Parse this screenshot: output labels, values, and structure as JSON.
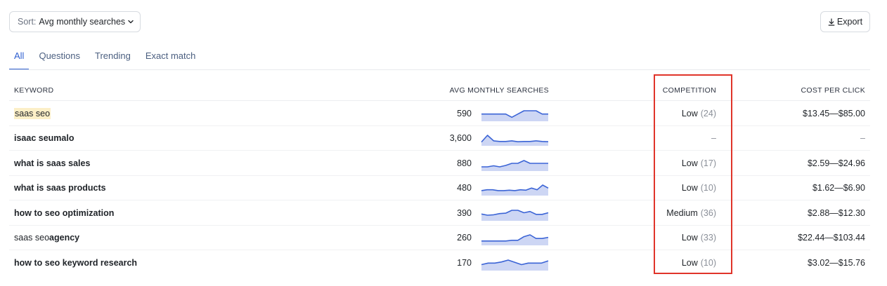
{
  "toolbar": {
    "sort_prefix": "Sort:",
    "sort_value": "Avg monthly searches",
    "export_label": "Export"
  },
  "tabs": [
    {
      "label": "All",
      "active": true
    },
    {
      "label": "Questions",
      "active": false
    },
    {
      "label": "Trending",
      "active": false
    },
    {
      "label": "Exact match",
      "active": false
    }
  ],
  "table": {
    "headers": {
      "keyword": "KEYWORD",
      "searches": "AVG MONTHLY SEARCHES",
      "competition": "COMPETITION",
      "cpc": "COST PER CLICK"
    },
    "rows": [
      {
        "keyword_parts": [
          {
            "t": "saas seo",
            "style": "hl"
          }
        ],
        "volume": "590",
        "trend": [
          2,
          2,
          2,
          2,
          2,
          1,
          2,
          3,
          3,
          3,
          2,
          2
        ],
        "competition": "Low",
        "comp_score": "(24)",
        "cpc": "$13.45—$85.00"
      },
      {
        "keyword_parts": [
          {
            "t": "isaac seumalo",
            "style": "bold"
          }
        ],
        "volume": "3,600",
        "trend": [
          1,
          3.2,
          1.4,
          1.2,
          1.2,
          1.4,
          1.1,
          1.2,
          1.2,
          1.4,
          1.2,
          1.1
        ],
        "competition": "–",
        "comp_score": "",
        "cpc": "–"
      },
      {
        "keyword_parts": [
          {
            "t": "what is saas sales",
            "style": "bold"
          }
        ],
        "volume": "880",
        "trend": [
          1,
          1,
          1.3,
          1,
          1.4,
          2,
          2,
          2.8,
          2,
          2,
          2,
          2
        ],
        "competition": "Low",
        "comp_score": "(17)",
        "cpc": "$2.59—$24.96"
      },
      {
        "keyword_parts": [
          {
            "t": "what is saas products",
            "style": "bold"
          }
        ],
        "volume": "480",
        "trend": [
          1,
          1.2,
          1.2,
          1,
          1,
          1.1,
          1,
          1.2,
          1.1,
          1.6,
          1.2,
          2.3,
          1.6
        ],
        "competition": "Low",
        "comp_score": "(10)",
        "cpc": "$1.62—$6.90"
      },
      {
        "keyword_parts": [
          {
            "t": "how to seo optimization",
            "style": "bold"
          }
        ],
        "volume": "390",
        "trend": [
          1.5,
          1.2,
          1.3,
          1.6,
          1.7,
          2.4,
          2.4,
          1.8,
          2.1,
          1.4,
          1.4,
          1.8
        ],
        "competition": "Medium",
        "comp_score": "(36)",
        "cpc": "$2.88—$12.30"
      },
      {
        "keyword_parts": [
          {
            "t": "saas seo ",
            "style": "light"
          },
          {
            "t": "agency",
            "style": "bold"
          }
        ],
        "volume": "260",
        "trend": [
          1,
          1,
          1,
          1,
          1,
          1.2,
          1.2,
          2.2,
          2.7,
          1.7,
          1.7,
          2
        ],
        "competition": "Low",
        "comp_score": "(33)",
        "cpc": "$22.44—$103.44"
      },
      {
        "keyword_parts": [
          {
            "t": "how to seo keyword research",
            "style": "bold"
          }
        ],
        "volume": "170",
        "trend": [
          1.4,
          1.8,
          1.8,
          2.1,
          2.6,
          2,
          1.4,
          1.8,
          1.8,
          1.8,
          2.4
        ],
        "competition": "Low",
        "comp_score": "(10)",
        "cpc": "$3.02—$15.76"
      }
    ]
  },
  "colors": {
    "accent": "#2f5fd0",
    "spark_line": "#3b64d6",
    "spark_fill": "#cdd6f4",
    "highlight_box": "#e0342a",
    "keyword_highlight": "#fcefc7"
  }
}
